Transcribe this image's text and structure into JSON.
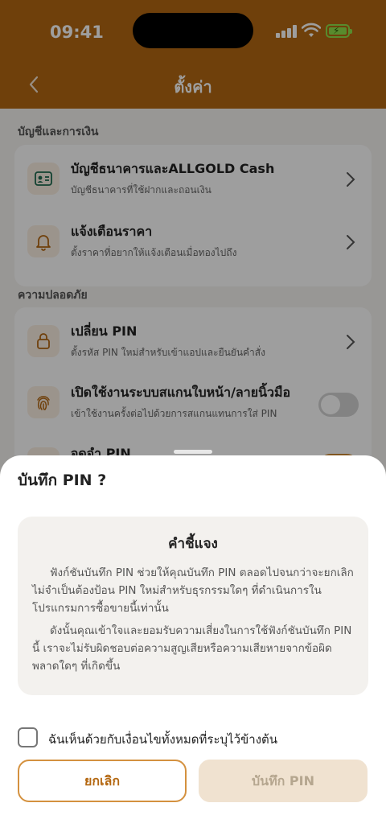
{
  "status_bar": {
    "time": "09:41"
  },
  "header": {
    "title": "ตั้งค่า"
  },
  "sections": [
    {
      "label": "บัญชีและการเงิน",
      "items": [
        {
          "title": "บัญชีธนาคารและALLGOLD Cash",
          "subtitle": "บัญชีธนาคารที่ใช้ฝากและถอนเงิน",
          "icon": "id-card-icon"
        },
        {
          "title": "แจ้งเตือนราคา",
          "subtitle": "ตั้งราคาที่อยากให้แจ้งเตือนเมื่อทองไปถึง",
          "icon": "bell-icon"
        }
      ]
    },
    {
      "label": "ความปลอดภัย",
      "items": [
        {
          "title": "เปลี่ยน PIN",
          "subtitle": "ตั้งรหัส PIN ใหม่สำหรับเข้าแอปและยืนยันคำสั่ง",
          "icon": "lock-icon"
        },
        {
          "title": "เปิดใช้งานระบบสแกนใบหน้า/ลายนิ้วมือ",
          "subtitle": "เข้าใช้งานครั้งต่อไปด้วยการสแกนแทนการใส่ PIN",
          "icon": "fingerprint-icon",
          "toggle": false
        },
        {
          "title": "จดจำ PIN",
          "icon": "save-icon",
          "toggle": true
        }
      ]
    }
  ],
  "sheet": {
    "title": "บันทึก PIN ?",
    "notice_title": "คำชี้แจง",
    "paragraph_1": "ฟังก์ชันบันทึก PIN ช่วยให้คุณบันทึก PIN ตลอดไปจนกว่าจะยกเลิก ไม่จำเป็นต้องป้อน PIN ใหม่สำหรับธุรกรรมใดๆ ที่ดำเนินการในโปรแกรมการซื้อขายนี้เท่านั้น",
    "paragraph_2": "ดังนั้นคุณเข้าใจและยอมรับความเสี่ยงในการใช้ฟังก์ชันบันทึก PIN นี้ เราจะไม่รับผิดชอบต่อความสูญเสียหรือความเสียหายจากข้อผิดพลาดใดๆ ที่เกิดขึ้น",
    "agree_label": "ฉันเห็นด้วยกับเงื่อนไขทั้งหมดที่ระบุไว้ข้างต้น",
    "agree_checked": false,
    "cancel_label": "ยกเลิก",
    "save_label": "บันทึก PIN"
  },
  "colors": {
    "brand": "#b46812",
    "accent": "#d4913f",
    "disabled_button": "#f0e2d0"
  }
}
